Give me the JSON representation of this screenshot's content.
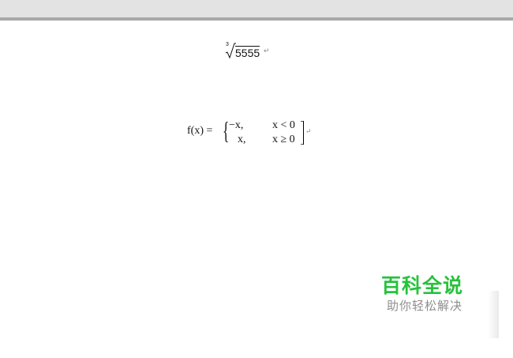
{
  "document": {
    "cube_root": {
      "index": "3",
      "radicand": "5555",
      "paragraph_mark": "↵"
    },
    "piecewise": {
      "label": "f(x) =",
      "brace": "{",
      "cases": [
        {
          "value": "−x,",
          "condition": "x < 0"
        },
        {
          "value": "x,",
          "condition": "x ≥ 0"
        }
      ],
      "paragraph_mark": "↵"
    }
  },
  "watermark": {
    "title": "百科全说",
    "subtitle": "助你轻松解决",
    "title_color": "#27c23c",
    "subtitle_color": "#8e8e8e"
  }
}
